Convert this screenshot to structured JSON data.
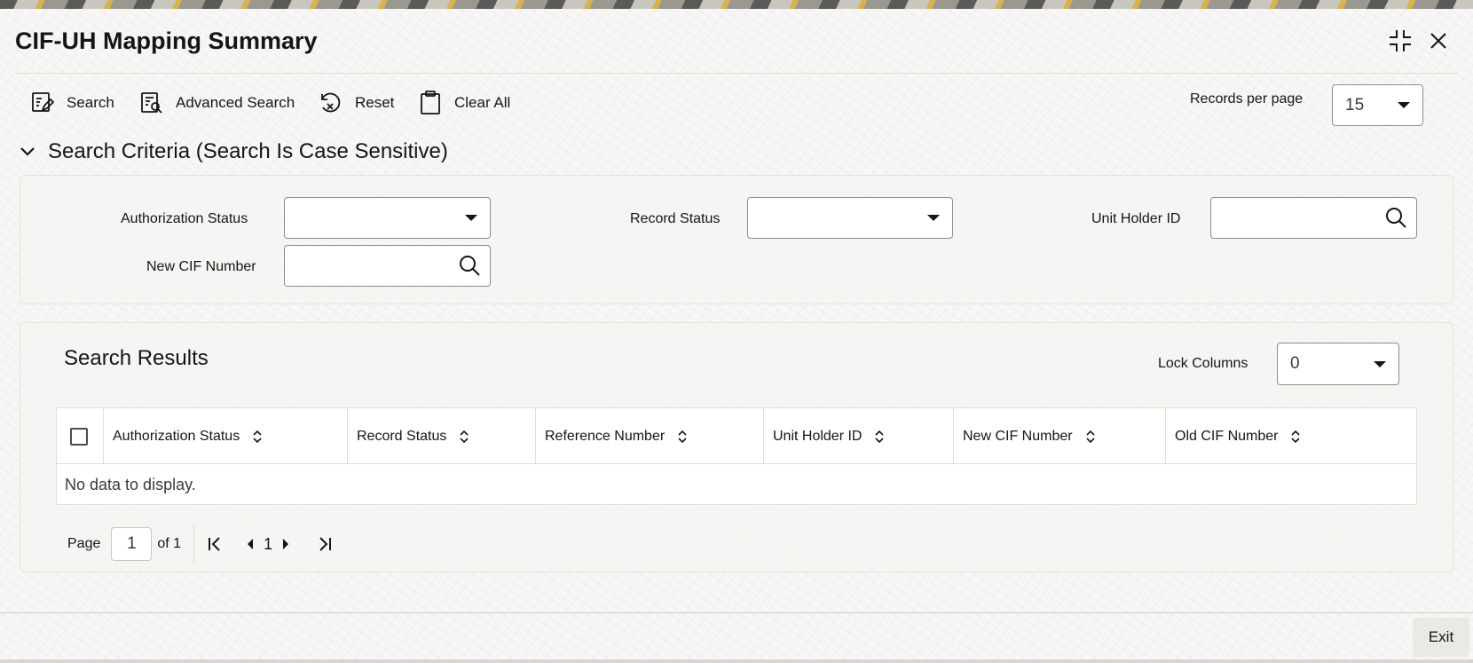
{
  "window": {
    "title": "CIF-UH Mapping Summary"
  },
  "toolbar": {
    "search_label": "Search",
    "advanced_search_label": "Advanced Search",
    "reset_label": "Reset",
    "clear_all_label": "Clear All",
    "records_per_page_label": "Records per page",
    "records_per_page_value": "15"
  },
  "criteria": {
    "heading": "Search Criteria (Search Is Case Sensitive)",
    "authorization_status_label": "Authorization Status",
    "authorization_status_value": "",
    "record_status_label": "Record Status",
    "record_status_value": "",
    "unit_holder_id_label": "Unit Holder ID",
    "unit_holder_id_value": "",
    "new_cif_number_label": "New CIF Number",
    "new_cif_number_value": ""
  },
  "results": {
    "title": "Search Results",
    "lock_columns_label": "Lock Columns",
    "lock_columns_value": "0",
    "columns": [
      "Authorization Status",
      "Record Status",
      "Reference Number",
      "Unit Holder ID",
      "New CIF Number",
      "Old CIF Number"
    ],
    "empty_message": "No data to display."
  },
  "pagination": {
    "page_label": "Page",
    "current_page": "1",
    "of_label": "of 1",
    "page_number": "1"
  },
  "footer": {
    "exit_label": "Exit"
  }
}
